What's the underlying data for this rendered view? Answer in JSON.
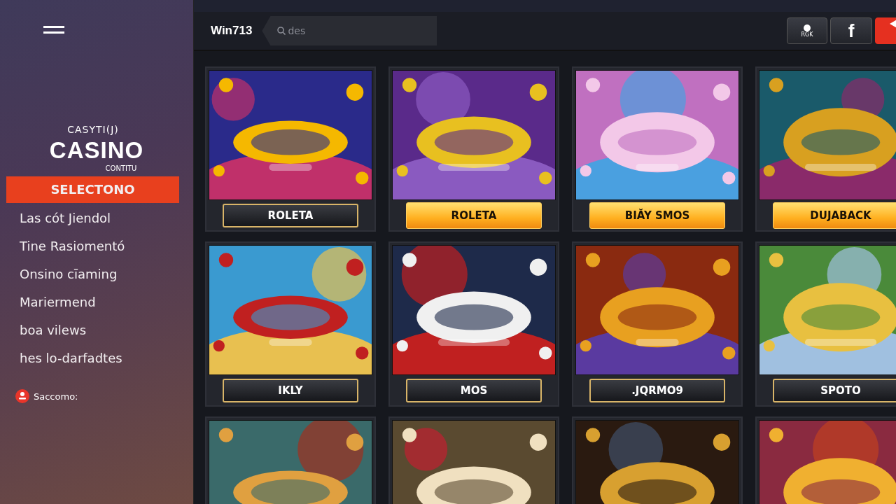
{
  "sidebar": {
    "logo": {
      "top": "CASYTI(J)",
      "main": "CASINO",
      "bottom": "CONTITU"
    },
    "items": [
      {
        "label": "SELECTONO",
        "selected": true
      },
      {
        "label": "Las cót Jiendol",
        "selected": false
      },
      {
        "label": "Tine Rasiomentó",
        "selected": false
      },
      {
        "label": "Onsino cīaming",
        "selected": false
      },
      {
        "label": "Mariermend",
        "selected": false
      },
      {
        "label": "boa vilews",
        "selected": false
      },
      {
        "label": "hes lo-darfadtes",
        "selected": false
      }
    ],
    "footer": "Saccomo:"
  },
  "topbar": {
    "brand": "Win713",
    "search": {
      "placeholder": "des"
    },
    "account": "RGK",
    "social": "f"
  },
  "games": [
    {
      "kind": "game",
      "label": "ROLETA",
      "highlighted": false
    },
    {
      "kind": "game",
      "label": "ROLETA",
      "highlighted": true
    },
    {
      "kind": "game",
      "label": "BIĂY SMOS",
      "highlighted": true
    },
    {
      "kind": "game",
      "label": "DUJABACK",
      "highlighted": true
    },
    {
      "kind": "game",
      "label": "IKLY",
      "highlighted": false
    },
    {
      "kind": "game",
      "label": "MOS",
      "highlighted": false
    },
    {
      "kind": "game",
      "label": ".JQRMO9",
      "highlighted": false
    },
    {
      "kind": "game",
      "label": "SPOTO",
      "highlighted": false
    },
    {
      "kind": "picture"
    },
    {
      "kind": "picture"
    },
    {
      "kind": "picture"
    },
    {
      "kind": "picture"
    }
  ]
}
